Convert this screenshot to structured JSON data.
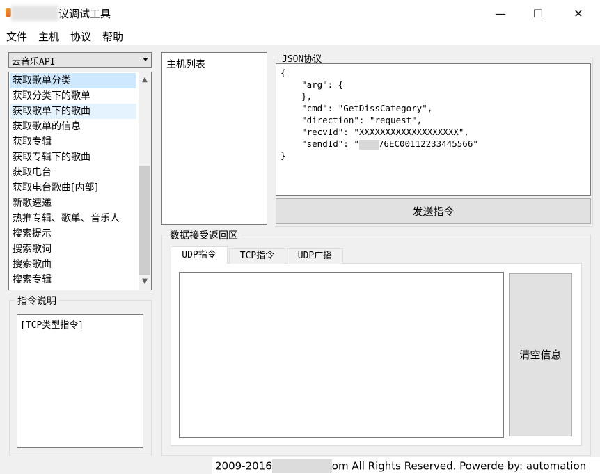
{
  "window": {
    "title_suffix": "议调试工具",
    "minimize": "—",
    "maximize": "☐",
    "close": "✕"
  },
  "menu": [
    "文件",
    "主机",
    "协议",
    "帮助"
  ],
  "api_selector": {
    "value": "云音乐API"
  },
  "api_list": {
    "items": [
      "获取歌单分类",
      "获取分类下的歌单",
      "获取歌单下的歌曲",
      "获取歌单的信息",
      "获取专辑",
      "获取专辑下的歌曲",
      "获取电台",
      "获取电台歌曲[内部]",
      "新歌速递",
      "热推专辑、歌单、音乐人",
      "搜索提示",
      "搜索歌词",
      "搜索歌曲",
      "搜索专辑"
    ],
    "selected": 0,
    "hovered": 2
  },
  "command_desc": {
    "title": "指令说明",
    "text": "[TCP类型指令]"
  },
  "host_list": {
    "title": "主机列表"
  },
  "json_protocol": {
    "title": "JSON协议",
    "lines": [
      "{",
      "    \"arg\": {",
      "    },",
      "    \"cmd\": \"GetDissCategory\",",
      "    \"direction\": \"request\",",
      "    \"recvId\": \"XXXXXXXXXXXXXXXXXXX\",",
      "    \"sendId\": \"",
      "}"
    ],
    "send_id_tail": "76EC00112233445566\""
  },
  "send_button": {
    "label": "发送指令"
  },
  "receive_area": {
    "title": "数据接受返回区",
    "tabs": [
      "UDP指令",
      "TCP指令",
      "UDP广播"
    ],
    "active_tab": 0
  },
  "clear_button": {
    "label": "清空信息"
  },
  "status": {
    "prefix": "2009-2016",
    "suffix": "om All Rights Reserved. Powerde by:  automation"
  }
}
